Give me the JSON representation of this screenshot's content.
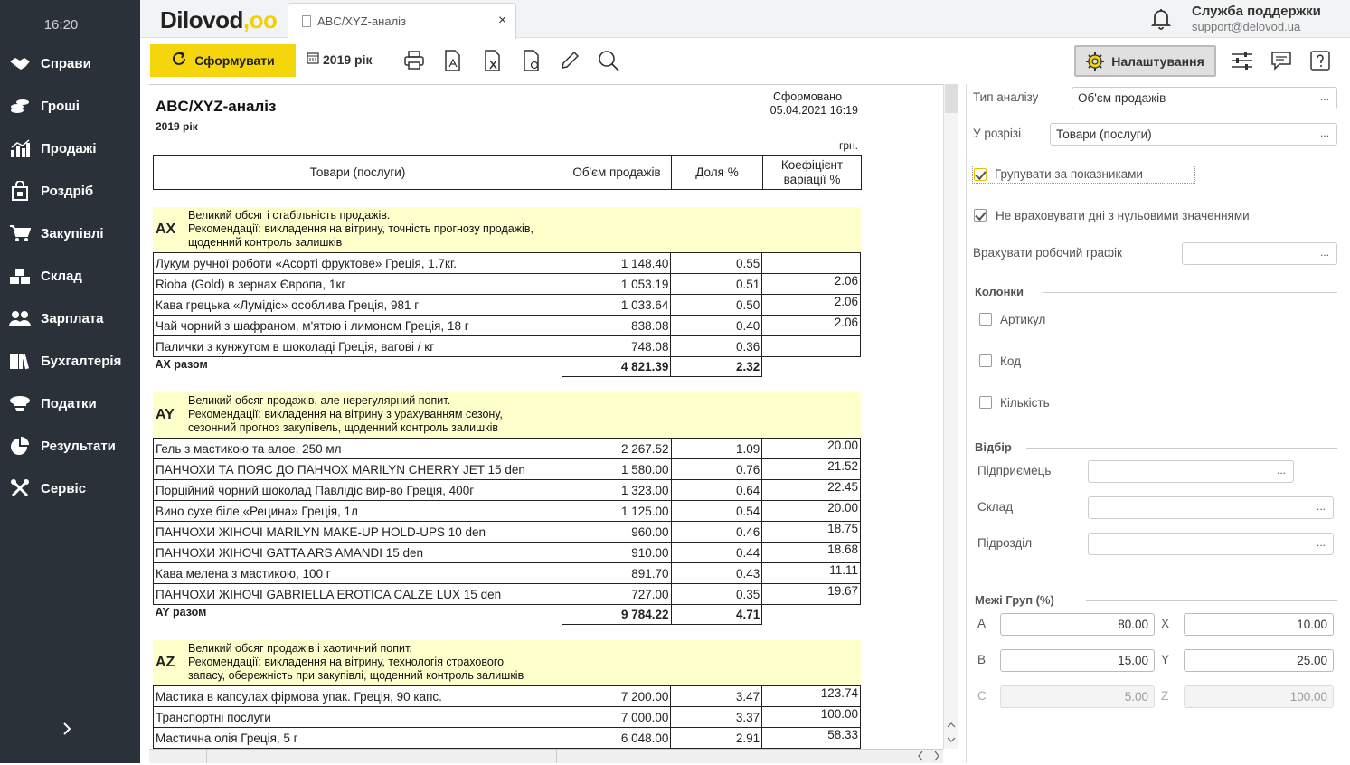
{
  "sidebar": {
    "time": "16:20",
    "items": [
      {
        "label": "Справи",
        "icon": "handshake-icon"
      },
      {
        "label": "Гроші",
        "icon": "coins-icon"
      },
      {
        "label": "Продажі",
        "icon": "chart-icon"
      },
      {
        "label": "Роздріб",
        "icon": "shopping-bag-icon"
      },
      {
        "label": "Закупівлі",
        "icon": "cart-icon"
      },
      {
        "label": "Склад",
        "icon": "boxes-icon"
      },
      {
        "label": "Зарплата",
        "icon": "people-icon"
      },
      {
        "label": "Бухгалтерія",
        "icon": "books-icon"
      },
      {
        "label": "Податки",
        "icon": "officer-cap-icon"
      },
      {
        "label": "Результати",
        "icon": "pie-icon"
      },
      {
        "label": "Сервіс",
        "icon": "tools-icon"
      }
    ]
  },
  "header": {
    "logo_text": "Dilovod",
    "logo_dots": ",oo",
    "tab_label": "ABC/XYZ-аналіз",
    "tab_close": "×",
    "support_title": "Служба поддержки",
    "support_email": "support@delovod.ua"
  },
  "toolbar": {
    "form_label": "Сформувати",
    "year_label": "2019 рік",
    "settings_label": "Налаштування"
  },
  "report": {
    "title": "ABC/XYZ-аналіз",
    "year": "2019 рік",
    "created_label": "Сформовано",
    "created_date": "05.04.2021 16:19",
    "currency": "грн.",
    "columns": [
      "Товари (послуги)",
      "Об'єм продажів",
      "Доля %",
      "Коефіцієнт варіації %"
    ],
    "groups": [
      {
        "code": "AX",
        "desc": [
          "Великий обсяг і стабільність продажів.",
          "Рекомендації: викладення на вітрину, точність прогнозу продажів,",
          "щоденний контроль залишків"
        ],
        "rows": [
          {
            "name": "Лукум ручної роботи «Асорті фруктове» Греція, 1.7кг.",
            "sales": "1 148.40",
            "share": "0.55",
            "cv": ""
          },
          {
            "name": "Rioba (Gold) в зернах Європа, 1кг",
            "sales": "1 053.19",
            "share": "0.51",
            "cv": "2.06"
          },
          {
            "name": "Кава грецька «Лумідіс» особлива Греція, 981 г",
            "sales": "1 033.64",
            "share": "0.50",
            "cv": "2.06"
          },
          {
            "name": "Чай чорний з шафраном, м'ятою і лимоном Греція, 18 г",
            "sales": "838.08",
            "share": "0.40",
            "cv": "2.06"
          },
          {
            "name": "Палички з кунжутом в шоколаді Греція, вагові / кг",
            "sales": "748.08",
            "share": "0.36",
            "cv": ""
          }
        ],
        "total_label": "AX разом",
        "total_sales": "4 821.39",
        "total_share": "2.32"
      },
      {
        "code": "AY",
        "desc": [
          "Великий обсяг продажів, але нерегулярний попит.",
          "Рекомендації: викладення на вітрину з урахуванням сезону,",
          "сезонний прогноз закупівель, щоденний контроль залишків"
        ],
        "rows": [
          {
            "name": "Гель з мастикою та алое, 250 мл",
            "sales": "2 267.52",
            "share": "1.09",
            "cv": "20.00"
          },
          {
            "name": "ПАНЧОХИ ТА ПОЯС ДО ПАНЧОХ MARILYN CHERRY JET 15 den",
            "sales": "1 580.00",
            "share": "0.76",
            "cv": "21.52"
          },
          {
            "name": "Порційний чорний шоколад Павлідіс вир-во Греція, 400г",
            "sales": "1 323.00",
            "share": "0.64",
            "cv": "22.45"
          },
          {
            "name": "Вино сухе біле «Рецина» Греція, 1л",
            "sales": "1 125.00",
            "share": "0.54",
            "cv": "20.00"
          },
          {
            "name": "ПАНЧОХИ ЖІНОЧІ MARILYN MAKE-UP HOLD-UPS 10 den",
            "sales": "960.00",
            "share": "0.46",
            "cv": "18.75"
          },
          {
            "name": "ПАНЧОХИ ЖІНОЧІ GATTA ARS AMANDI 15 den",
            "sales": "910.00",
            "share": "0.44",
            "cv": "18.68"
          },
          {
            "name": "Кава мелена з мастикою, 100 г",
            "sales": "891.70",
            "share": "0.43",
            "cv": "11.11"
          },
          {
            "name": "ПАНЧОХИ ЖІНОЧІ GABRIELLA EROTICA CALZE LUX 15 den",
            "sales": "727.00",
            "share": "0.35",
            "cv": "19.67"
          }
        ],
        "total_label": "AY разом",
        "total_sales": "9 784.22",
        "total_share": "4.71"
      },
      {
        "code": "AZ",
        "desc": [
          "Великий обсяг продажів і хаотичний попит.",
          "Рекомендації: викладення на вітрину, технологія страхового",
          "запасу, обережність при закупівлі, щоденний контроль залишків"
        ],
        "rows": [
          {
            "name": "Мастика в капсулах фірмова упак. Греція, 90 капс.",
            "sales": "7 200.00",
            "share": "3.47",
            "cv": "123.74"
          },
          {
            "name": "Транспортні послуги",
            "sales": "7 000.00",
            "share": "3.37",
            "cv": "100.00"
          },
          {
            "name": "Мастична олія Греція, 5 г",
            "sales": "6 048.00",
            "share": "2.91",
            "cv": "58.33"
          },
          {
            "name": "",
            "sales": "",
            "share": "",
            "cv": ""
          }
        ]
      }
    ]
  },
  "settings": {
    "analysis_type_label": "Тип аналізу",
    "analysis_type_value": "Об'єм продажів",
    "slice_label": "У розрізі",
    "slice_value": "Товари (послуги)",
    "group_by_label": "Групувати за показниками",
    "group_by_checked": true,
    "ignore_zero_label": "Не враховувати дні з нульовими значеннями",
    "ignore_zero_checked": true,
    "schedule_label": "Врахувати робочий графік",
    "schedule_value": "",
    "columns_section": "Колонки",
    "col_article": "Артикул",
    "col_code": "Код",
    "col_qty": "Кількість",
    "filter_section": "Відбір",
    "filter_entrepreneur": "Підприємець",
    "filter_warehouse": "Склад",
    "filter_department": "Підрозділ",
    "bounds_section": "Межі Груп (%)",
    "bounds": {
      "A": "80.00",
      "B": "15.00",
      "C": "5.00",
      "X": "10.00",
      "Y": "25.00",
      "Z": "100.00"
    },
    "dots": "..."
  }
}
